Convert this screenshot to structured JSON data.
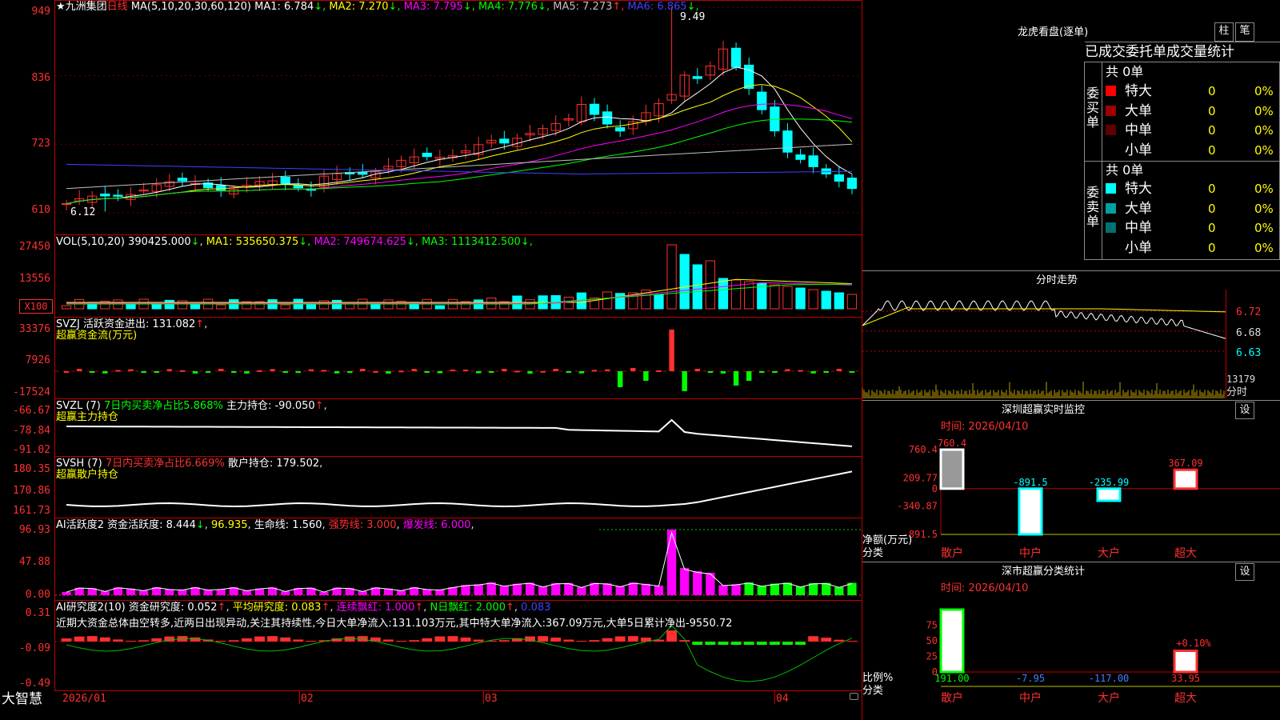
{
  "main_chart": {
    "stock_name": "★九洲集团",
    "period": "日线",
    "ma_params": "MA(5,10,20,30,60,120)",
    "ma_values": [
      {
        "label": "MA1: 6.784",
        "arrow": "↓",
        "color": "#ffffff"
      },
      {
        "label": "MA2: 7.270",
        "arrow": "↓",
        "color": "#ffff00"
      },
      {
        "label": "MA3: 7.795",
        "arrow": "↓",
        "color": "#ff00ff"
      },
      {
        "label": "MA4: 7.776",
        "arrow": "↓",
        "color": "#00ff00"
      },
      {
        "label": "MA5: 7.273",
        "arrow": "↑",
        "color": "#c0c0c0"
      },
      {
        "label": "MA6: 6.865",
        "arrow": "↓",
        "color": "#4040ff"
      }
    ],
    "axis": [
      "949",
      "836",
      "723",
      "610"
    ],
    "high_mark": "9.49",
    "low_mark": "6.12"
  },
  "vol_panel": {
    "title": "VOL(5,10,20)",
    "value": "390425.000",
    "items": [
      {
        "label": "MA1: 535650.375",
        "color": "#ffff00"
      },
      {
        "label": "MA2: 749674.625",
        "color": "#ff00ff"
      },
      {
        "label": "MA3: 1113412.500",
        "color": "#00ff00"
      }
    ],
    "axis": [
      "27450",
      "13556"
    ],
    "unit": "X100"
  },
  "svzj_panel": {
    "title": "SVZJ  活跃资金进出: 131.082",
    "subtitle": "超赢资金流(万元)",
    "axis": [
      "33376",
      "7926",
      "-17524"
    ]
  },
  "svzl_panel": {
    "title": "SVZL (7)",
    "detail": "7日内买卖净占比5.868%",
    "value": "主力持仓: -90.050",
    "subtitle": "超赢主力持仓",
    "axis": [
      "-66.67",
      "-78.84",
      "-91.02"
    ]
  },
  "svsh_panel": {
    "title": "SVSH (7)",
    "detail": "7日内买卖净占比6.669%",
    "value": "散户持仓: 179.502",
    "subtitle": "超赢散户持仓",
    "axis": [
      "180.35",
      "170.86",
      "161.73"
    ]
  },
  "ai_active_panel": {
    "title": "AI活跃度2 资金活跃度: 8.444",
    "v2": "96.935",
    "v3": "生命线: 1.560",
    "v4": "强势线: 3.000",
    "v5": "爆发线: 6.000",
    "axis": [
      "96.93",
      "47.88",
      "0.00"
    ]
  },
  "ai_research_panel": {
    "title": "AI研究度2(10) 资金研究度: 0.052",
    "v2": "平均研究度: 0.083",
    "v3": "连续飘红: 1.000",
    "v4": "N日飘红: 2.000",
    "v5": "0.083",
    "commentary": "近期大资金总体由空转多,近两日出现异动,关注其持续性,今日大单净流入:131.103万元,其中特大单净流入:367.09万元,大单5日累计净出-9550.72",
    "axis": [
      "0.31",
      "-0.09",
      "-0.49"
    ]
  },
  "bottom_bar": {
    "logo": "大智慧",
    "dates": [
      "2026/01",
      "02",
      "03",
      "04"
    ]
  },
  "dragon_tiger": {
    "title": "龙虎看盘(逐单)",
    "btn1": "柱",
    "btn2": "笔",
    "tabs": [
      "已成交",
      "委托单",
      "成交量统计"
    ],
    "buy_label": "委买单",
    "sell_label": "委卖单",
    "buy_total": "共 0单",
    "sell_total": "共 0单",
    "buy_rows": [
      {
        "name": "特大",
        "count": "0",
        "pct": "0%",
        "color": "#ff0000"
      },
      {
        "name": "大单",
        "count": "0",
        "pct": "0%",
        "color": "#a00000"
      },
      {
        "name": "中单",
        "count": "0",
        "pct": "0%",
        "color": "#600000"
      },
      {
        "name": "小单",
        "count": "0",
        "pct": "0%",
        "color": ""
      }
    ],
    "sell_rows": [
      {
        "name": "特大",
        "count": "0",
        "pct": "0%",
        "color": "#00ffff"
      },
      {
        "name": "大单",
        "count": "0",
        "pct": "0%",
        "color": "#00a0a0"
      },
      {
        "name": "中单",
        "count": "0",
        "pct": "0%",
        "color": "#007070"
      },
      {
        "name": "小单",
        "count": "0",
        "pct": "0%",
        "color": ""
      }
    ]
  },
  "intraday": {
    "title": "分时走势",
    "axis": [
      "6.72",
      "6.68",
      "6.63"
    ],
    "vol_label": "13179",
    "vol_unit": "分时"
  },
  "sz_monitor": {
    "title": "深圳超赢实时监控",
    "settings": "设",
    "time": "时间: 2026/04/10",
    "axis": [
      "760.4",
      "209.77",
      "0",
      "-340.87",
      "-891.5"
    ],
    "ylabel": "净额(万元)",
    "xlabel": "分类",
    "bars": [
      {
        "cat": "散户",
        "value": 760.4,
        "label": "760.4"
      },
      {
        "cat": "中户",
        "value": -891.5,
        "label": "-891.5"
      },
      {
        "cat": "大户",
        "value": -235.99,
        "label": "-235.99"
      },
      {
        "cat": "超大",
        "value": 367.09,
        "label": "367.09"
      }
    ]
  },
  "sz_category": {
    "title": "深市超赢分类统计",
    "settings": "设",
    "time": "时间: 2026/04/10",
    "axis": [
      "75",
      "50",
      "25",
      "0"
    ],
    "ylabel": "比例%",
    "xlabel": "分类",
    "pct_label": "+0.10%",
    "bars": [
      {
        "cat": "散户",
        "value": 191.0,
        "label": "191.00"
      },
      {
        "cat": "中户",
        "value": -7.95,
        "label": "-7.95"
      },
      {
        "cat": "大户",
        "value": -117.0,
        "label": "-117.00"
      },
      {
        "cat": "超大",
        "value": 33.95,
        "label": "33.95"
      }
    ]
  },
  "colors": {
    "up": "#ff3030",
    "down": "#00ffff",
    "grid": "#a00000",
    "text": "#dddddd",
    "yellow": "#ffff00",
    "magenta": "#ff00ff",
    "green": "#00ff00"
  }
}
